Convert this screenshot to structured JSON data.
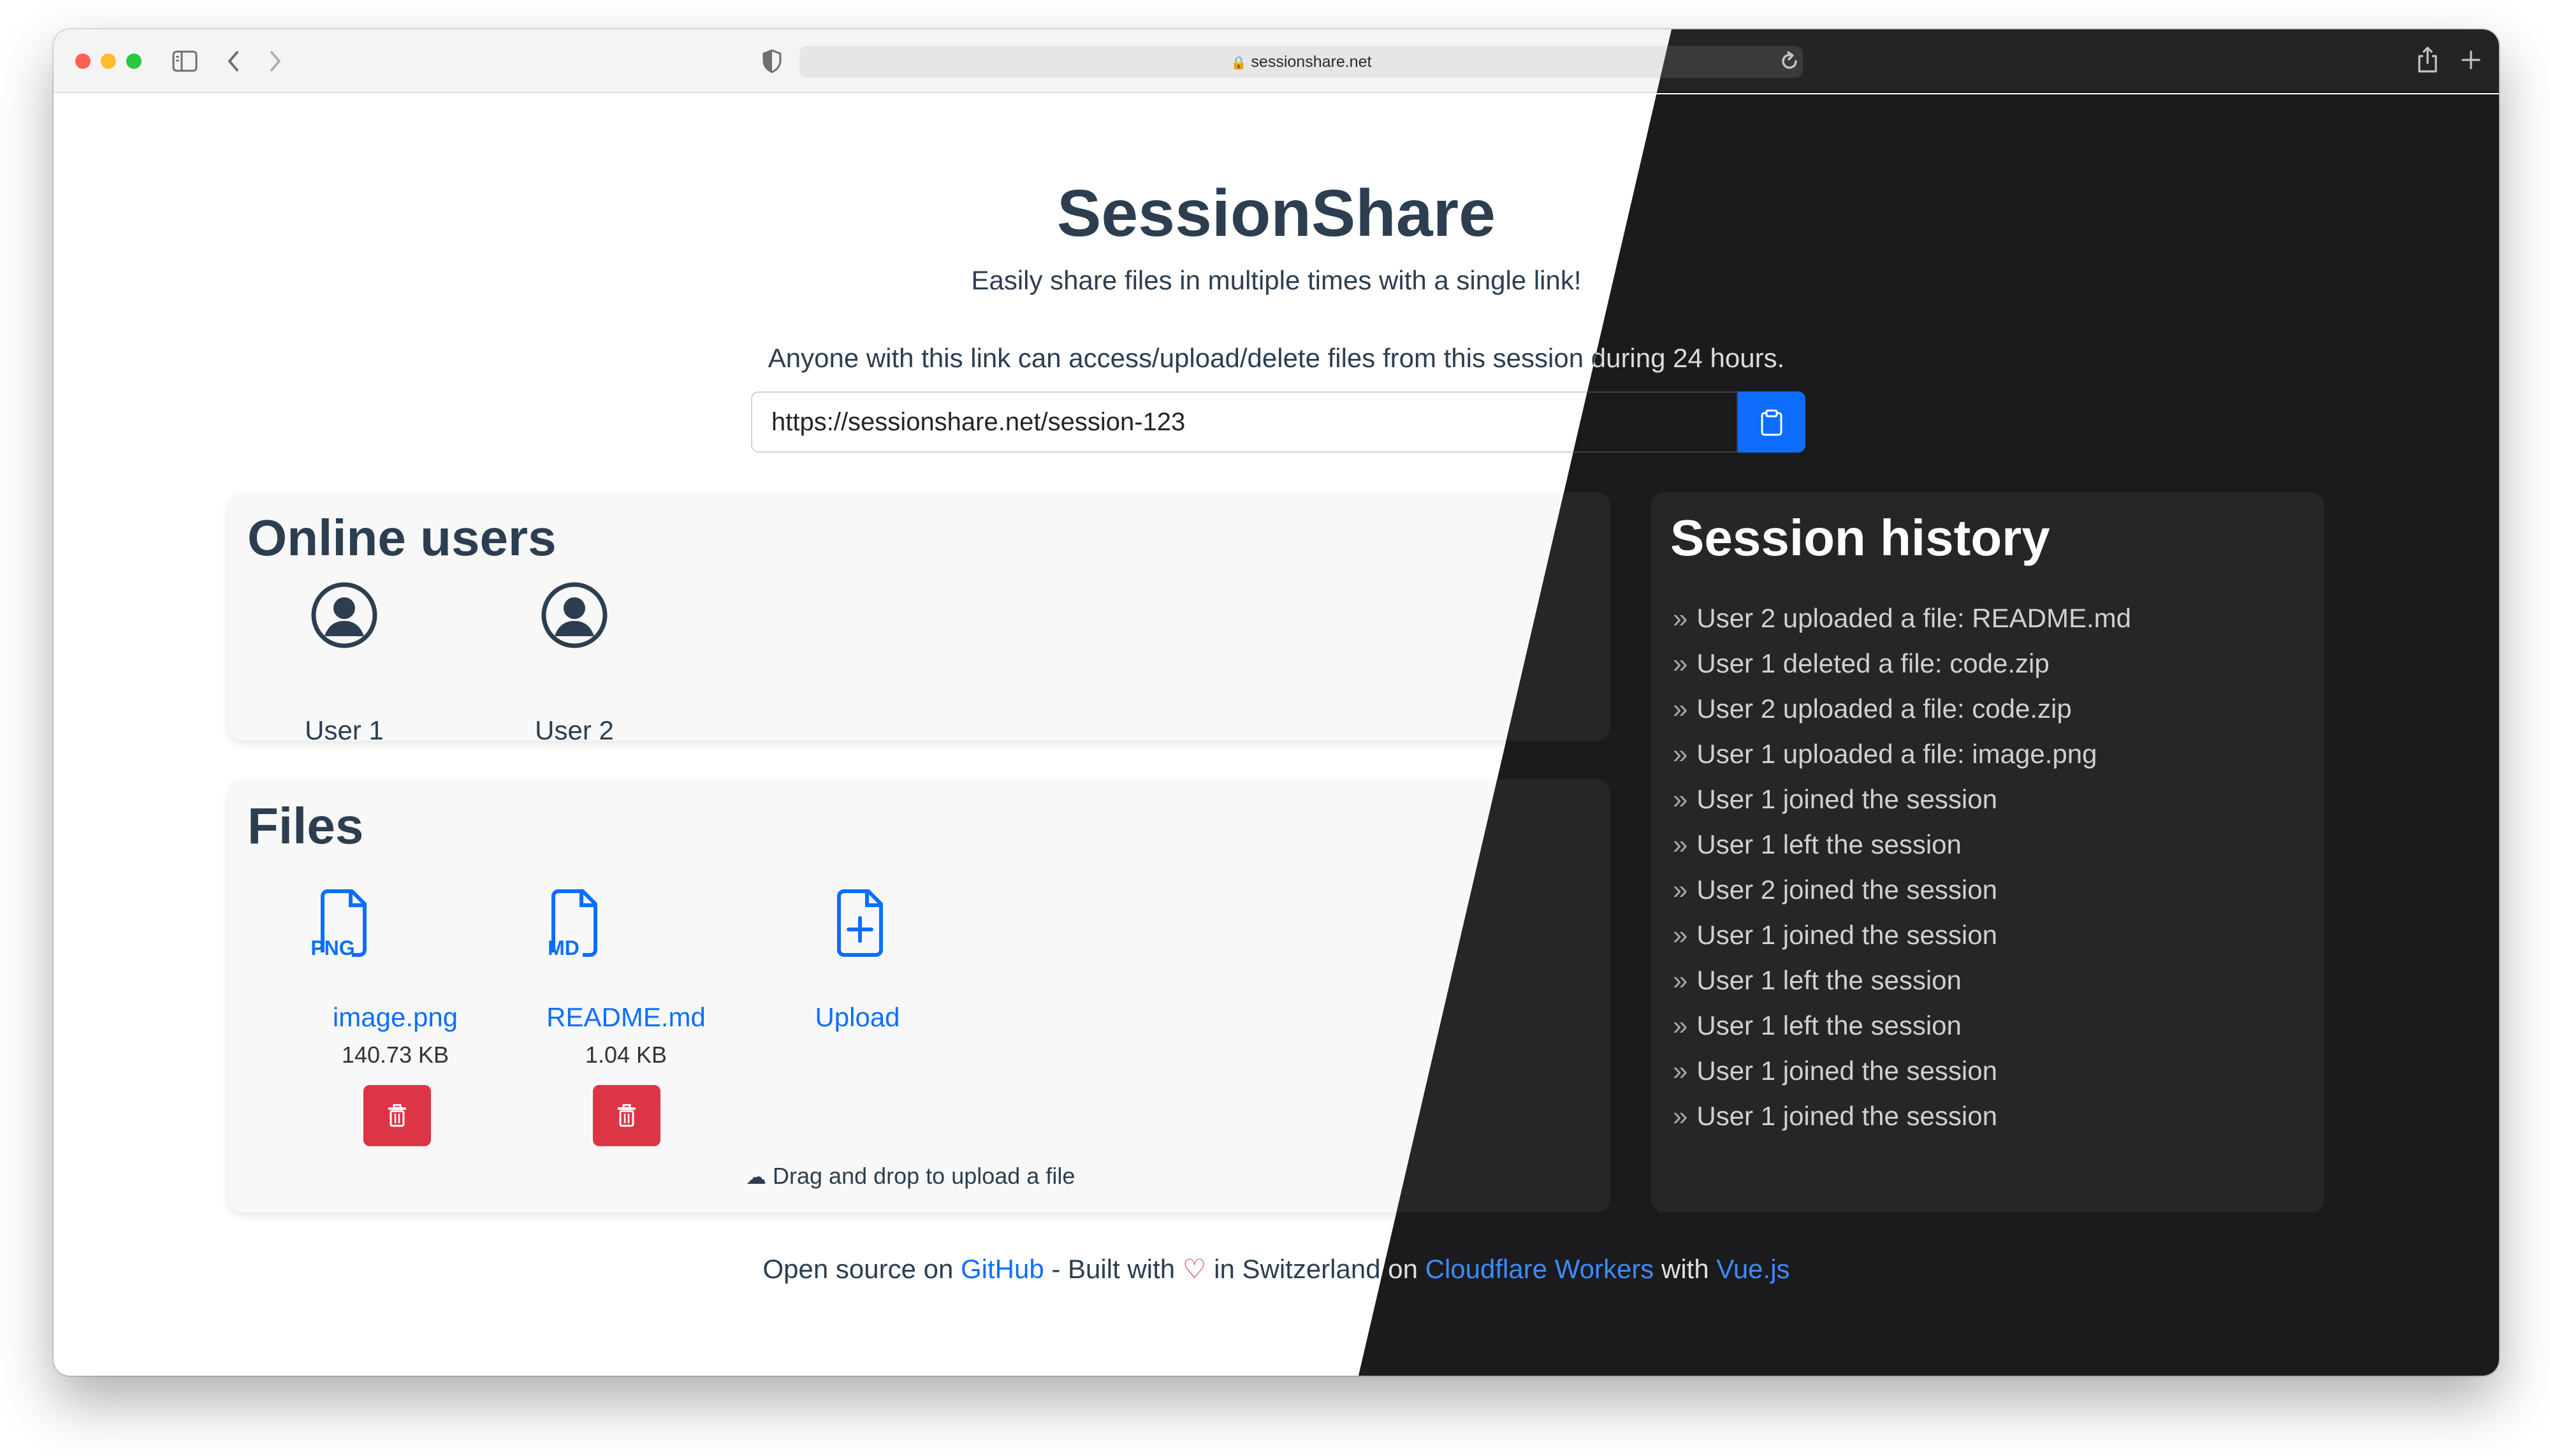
{
  "browser": {
    "url": "sessionshare.net",
    "controls": [
      "sidebar-icon",
      "back-icon",
      "forward-icon",
      "shield-icon",
      "lock-icon",
      "reload-icon",
      "share-icon",
      "new-tab-icon",
      "tabs-icon"
    ]
  },
  "page": {
    "title": "SessionShare",
    "subtitle": "Easily share files in multiple times with a single link!",
    "notice": "Anyone with this link can access/upload/delete files from this session during 24 hours.",
    "session_link": "https://sessionshare.net/session-123"
  },
  "online_users": {
    "title": "Online users",
    "users": [
      "User 1",
      "User 2"
    ]
  },
  "files": {
    "title": "Files",
    "items": [
      {
        "badge": "PNG",
        "name": "image.png",
        "size": "140.73 KB"
      },
      {
        "badge": "MD",
        "name": "README.md",
        "size": "1.04 KB"
      }
    ],
    "upload_label": "Upload",
    "drag_hint": "Drag and drop to upload a file"
  },
  "history": {
    "title": "Session history",
    "items": [
      "User 2 uploaded a file: README.md",
      "User 1 deleted a file: code.zip",
      "User 2 uploaded a file: code.zip",
      "User 1 uploaded a file: image.png",
      "User 1 joined the session",
      "User 1 left the session",
      "User 2 joined the session",
      "User 1 joined the session",
      "User 1 left the session",
      "User 1 left the session",
      "User 1 joined the session",
      "User 1 joined the session"
    ]
  },
  "footer": {
    "open_source": "Open source on",
    "github": "GitHub",
    "built_with": "- Built with",
    "in_switzerland": "in Switzerland on",
    "cloudflare": "Cloudflare Workers",
    "with": "with",
    "vue": "Vue.js"
  },
  "colors": {
    "accent": "#0d6efd",
    "danger": "#dc3545",
    "text": "#2c3e50",
    "dark_bg": "#1b1b1d"
  }
}
